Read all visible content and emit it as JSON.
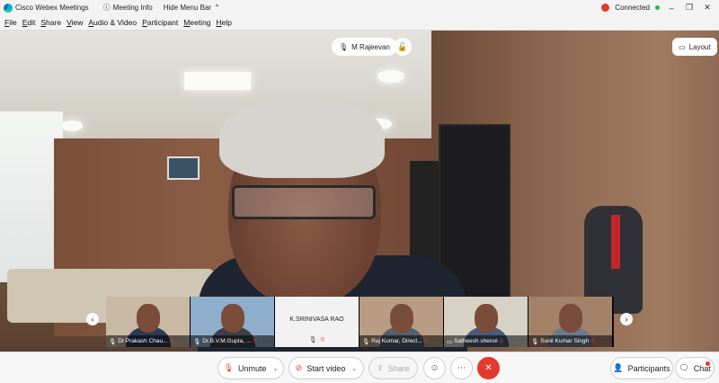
{
  "titlebar": {
    "app_title": "Cisco Webex Meetings",
    "meeting_info": "Meeting Info",
    "hide_menu": "Hide Menu Bar",
    "connection": "Connected",
    "minimize": "–",
    "maximize": "❐",
    "close": "✕"
  },
  "menu": [
    "File",
    "Edit",
    "Share",
    "View",
    "Audio & Video",
    "Participant",
    "Meeting",
    "Help"
  ],
  "stage": {
    "active_speaker": "M Rajeevan",
    "layout_label": "Layout"
  },
  "filmstrip": {
    "tiles": [
      {
        "name": "Dr Prakash Chau...",
        "bg": "#c9b9a4"
      },
      {
        "name": "Dr.B.V.M.Gupta, ...",
        "bg": "#8eaecc"
      },
      {
        "name": "K.SRINIVASA RAO",
        "bg": "#f2f2f2"
      },
      {
        "name": "Raj Kumar, Direct...",
        "bg": "#b89c84"
      },
      {
        "name": "Satheesh shenoi",
        "bg": "#d8d2c6"
      },
      {
        "name": "Sunil Kumar Singh",
        "bg": "#a4826a"
      }
    ]
  },
  "controls": {
    "unmute": "Unmute",
    "start_video": "Start video",
    "share": "Share",
    "participants": "Participants",
    "chat": "Chat"
  },
  "colors": {
    "leave": "#e23b2e",
    "mute_red": "#e23b2e"
  }
}
